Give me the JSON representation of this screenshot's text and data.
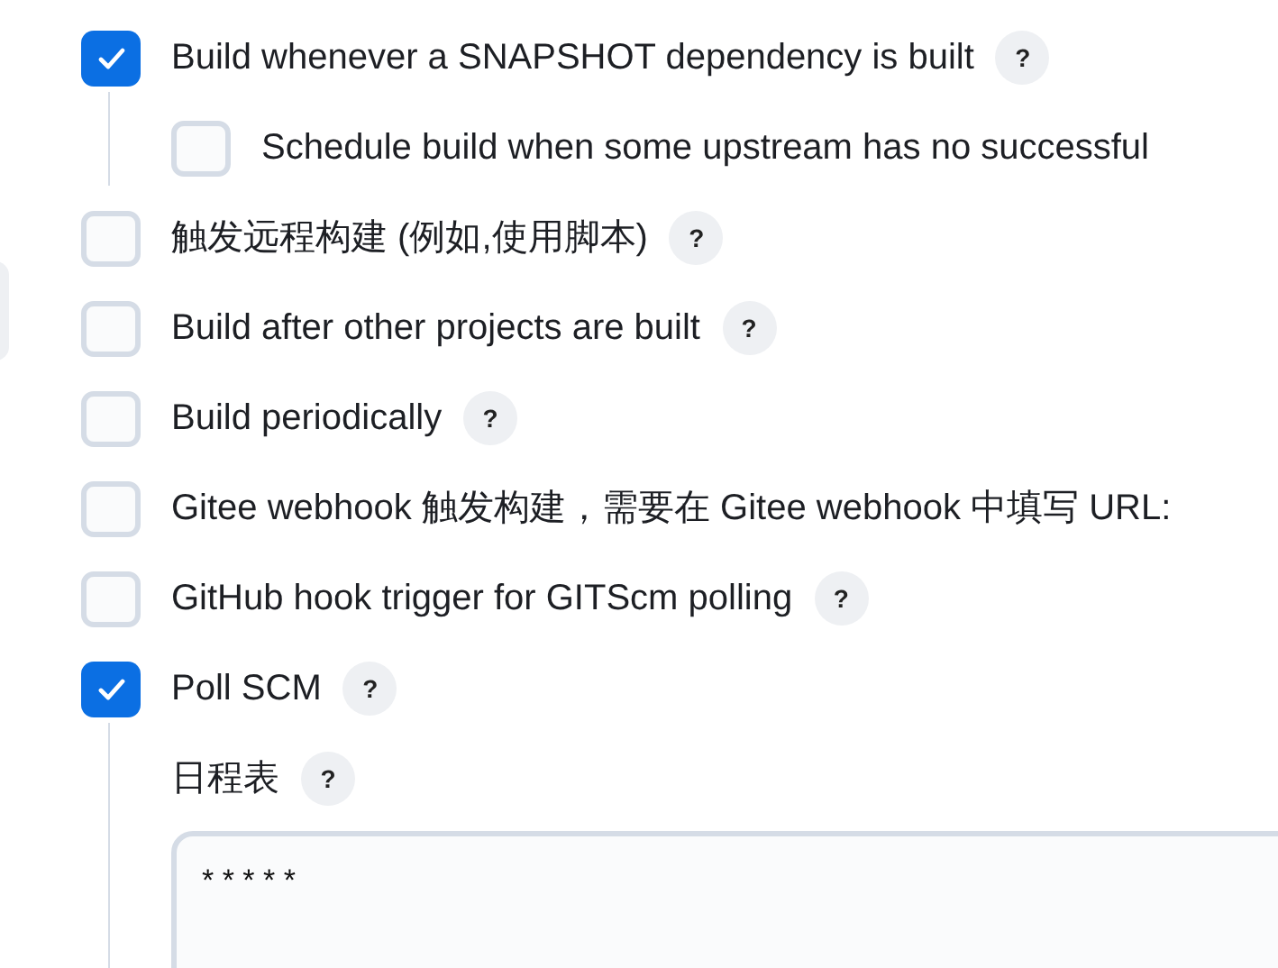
{
  "triggers": [
    {
      "kind": "checkbox",
      "label": "Build whenever a SNAPSHOT dependency is built",
      "checked": true,
      "help": "?",
      "children": [
        {
          "kind": "checkbox",
          "label": "Schedule build when some upstream has no successful",
          "checked": false
        }
      ]
    },
    {
      "kind": "checkbox",
      "label": "触发远程构建 (例如,使用脚本)",
      "checked": false,
      "help": "?"
    },
    {
      "kind": "checkbox",
      "label": "Build after other projects are built",
      "checked": false,
      "help": "?"
    },
    {
      "kind": "checkbox",
      "label": "Build periodically",
      "checked": false,
      "help": "?"
    },
    {
      "kind": "checkbox",
      "label": "Gitee webhook 触发构建，需要在 Gitee webhook 中填写 URL:",
      "checked": false
    },
    {
      "kind": "checkbox",
      "label": "GitHub hook trigger for GITScm polling",
      "checked": false,
      "help": "?"
    },
    {
      "kind": "checkbox",
      "label": "Poll SCM",
      "checked": true,
      "help": "?",
      "children": [
        {
          "kind": "textarea",
          "label": "日程表",
          "help": "?",
          "value": "* * * * *"
        }
      ]
    }
  ]
}
